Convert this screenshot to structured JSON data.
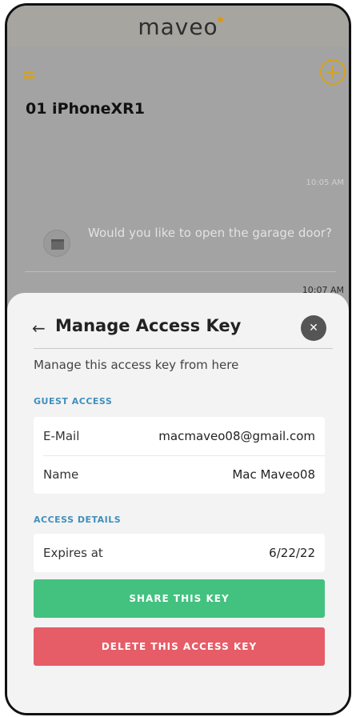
{
  "app": {
    "logo_text": "maveo",
    "accent_color": "#d7a21b"
  },
  "background_screen": {
    "device_title": "01 iPhoneXR1",
    "timestamps": [
      "10:05 AM",
      "10:07 AM"
    ],
    "message": {
      "text": "Would you like to open the garage door?",
      "icon": "garage-icon"
    },
    "icons": [
      "menu-icon",
      "add-circle-icon"
    ]
  },
  "sheet": {
    "title": "Manage Access Key",
    "subtitle": "Manage this access key from here",
    "guest_access": {
      "label": "GUEST ACCESS",
      "rows": [
        {
          "label": "E-Mail",
          "value": "macmaveo08@gmail.com"
        },
        {
          "label": "Name",
          "value": "Mac Maveo08"
        }
      ]
    },
    "access_details": {
      "label": "ACCESS DETAILS",
      "rows": [
        {
          "label": "Expires at",
          "value": "6/22/22"
        }
      ]
    },
    "buttons": {
      "share": "SHARE THIS KEY",
      "delete": "DELETE THIS ACCESS KEY"
    },
    "colors": {
      "share": "#43c17f",
      "delete": "#e65c67",
      "section_label": "#3f8fbd"
    }
  }
}
